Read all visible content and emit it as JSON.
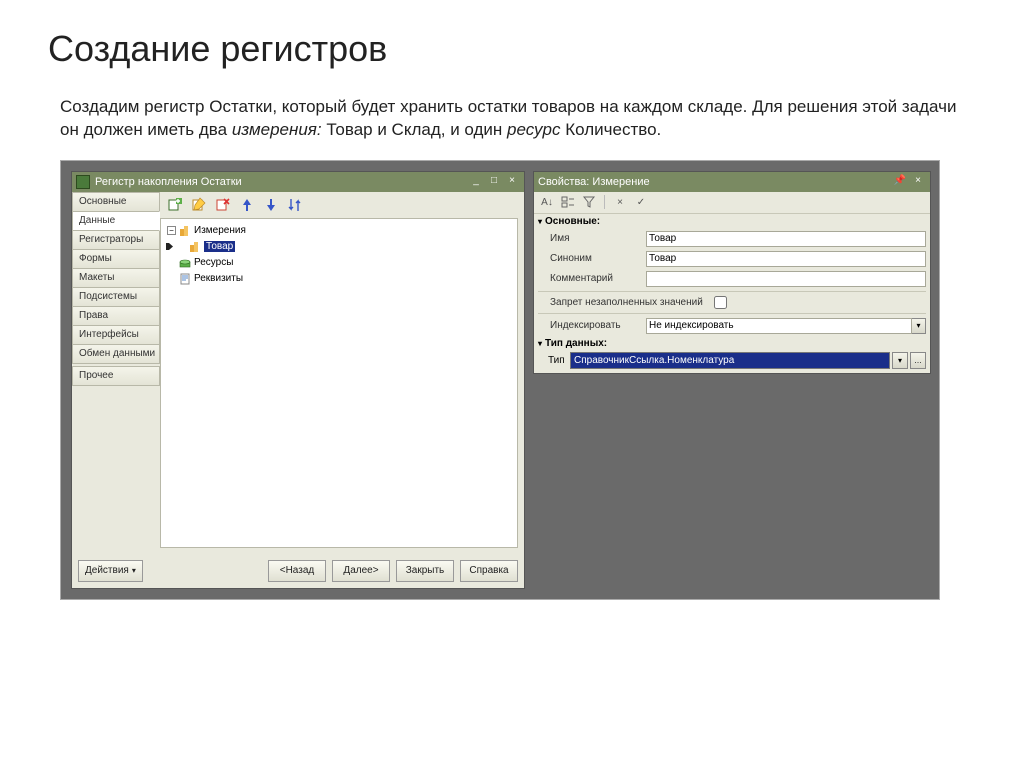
{
  "slide": {
    "title": "Создание регистров",
    "desc_plain": "Создадим регистр Остатки, который будет хранить остатки товаров на каждом складе. Для решения этой задачи он должен иметь два измерения: Товар и Склад, и один ресурс Количество."
  },
  "left": {
    "title": "Регистр накопления Остатки",
    "tabs": [
      "Основные",
      "Данные",
      "Регистраторы",
      "Формы",
      "Макеты",
      "Подсистемы",
      "Права",
      "Интерфейсы",
      "Обмен данными",
      "Прочее"
    ],
    "active_tab": 1,
    "tree": {
      "root": "Измерения",
      "child": "Товар",
      "res": "Ресурсы",
      "req": "Реквизиты"
    },
    "buttons": [
      "Действия",
      "<Назад",
      "Далее>",
      "Закрыть",
      "Справка"
    ]
  },
  "right": {
    "title": "Свойства: Измерение",
    "groups": {
      "main": "Основные:",
      "type": "Тип данных:"
    },
    "rows": {
      "name_l": "Имя",
      "name_v": "Товар",
      "syn_l": "Синоним",
      "syn_v": "Товар",
      "comm_l": "Комментарий",
      "comm_v": "",
      "deny_l": "Запрет незаполненных значений",
      "idx_l": "Индексировать",
      "idx_v": "Не индексировать",
      "type_l": "Тип",
      "type_v": "СправочникСсылка.Номенклатура"
    }
  }
}
